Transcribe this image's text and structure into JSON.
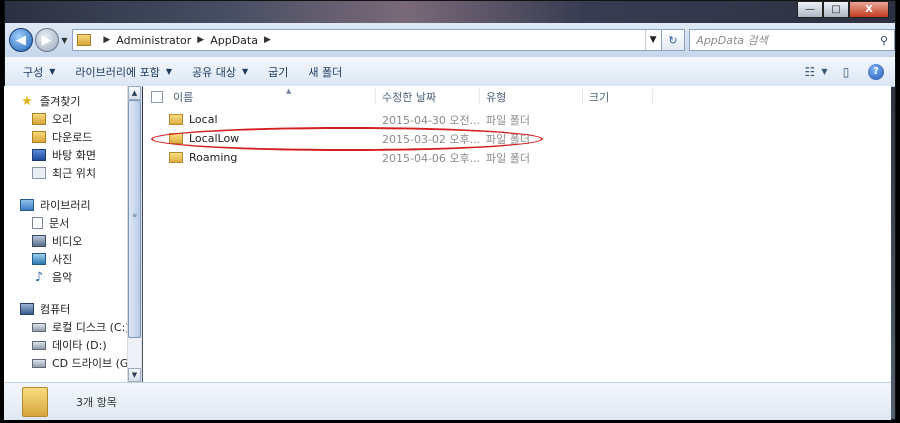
{
  "window": {
    "minimize": "—",
    "maximize": "□",
    "close": "X"
  },
  "address": {
    "breadcrumbs": [
      "Administrator",
      "AppData"
    ],
    "search_placeholder": "AppData 검색"
  },
  "toolbar": {
    "organize": "구성",
    "include_library": "라이브러리에 포함",
    "share": "공유 대상",
    "burn": "굽기",
    "new_folder": "새 폴더"
  },
  "nav": {
    "favorites": "즐겨찾기",
    "favorites_items": [
      "오리",
      "다운로드",
      "바탕 화면",
      "최근 위치"
    ],
    "libraries": "라이브러리",
    "libraries_items": [
      "문서",
      "비디오",
      "사진",
      "음악"
    ],
    "computer": "컴퓨터",
    "computer_items": [
      "로컬 디스크 (C:)",
      "데이타 (D:)",
      "CD 드라이브 (G:)"
    ]
  },
  "columns": {
    "name": "이름",
    "date": "수정한 날짜",
    "type": "유형",
    "size": "크기"
  },
  "files": [
    {
      "name": "Local",
      "date": "2015-04-30 오전...",
      "type": "파일 폴더"
    },
    {
      "name": "LocalLow",
      "date": "2015-03-02 오후...",
      "type": "파일 폴더"
    },
    {
      "name": "Roaming",
      "date": "2015-04-06 오후...",
      "type": "파일 폴더"
    }
  ],
  "status": {
    "count": "3개 항목"
  },
  "colors": {
    "highlight": "#d42020"
  }
}
